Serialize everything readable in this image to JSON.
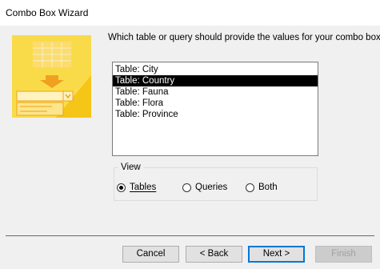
{
  "window": {
    "title": "Combo Box Wizard"
  },
  "prompt": "Which table or query should provide the values for your combo box?",
  "list": {
    "items": [
      "Table: City",
      "Table: Country",
      "Table: Fauna",
      "Table: Flora",
      "Table: Province"
    ],
    "selected": "Table: Country"
  },
  "view": {
    "label": "View",
    "options": [
      "Tables",
      "Queries",
      "Both"
    ],
    "selected": "Tables"
  },
  "buttons": {
    "cancel": "Cancel",
    "back": "< Back",
    "next": "Next >",
    "finish": "Finish"
  },
  "colors": {
    "illustration_yellow": "#f8d83a",
    "illustration_orange": "#f0a020",
    "selection": "#000000",
    "default_button_border": "#0078d7"
  }
}
